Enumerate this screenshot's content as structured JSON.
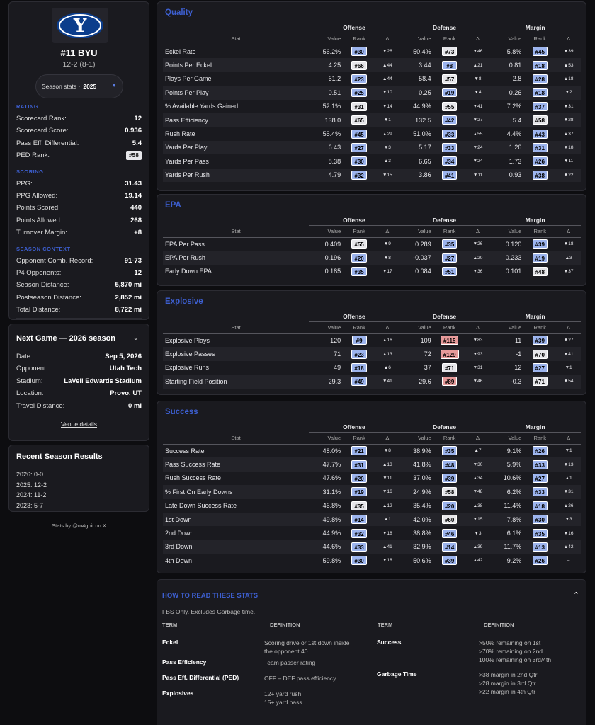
{
  "colors": {
    "accent": "#3d5fd0",
    "up": "#5fb86b",
    "down": "#d06a6a",
    "rank_blue": "#9cb4ee",
    "rank_light": "#e6e6ea",
    "rank_red": "#e79a9a"
  },
  "team": {
    "logo_text": "Y",
    "name": "#11 BYU",
    "record": "12-2 (8-1)",
    "season_label": "Season stats ·",
    "season_value": "2025"
  },
  "rating": {
    "title": "RATING",
    "rows": [
      {
        "label": "Scorecard Rank:",
        "value": "12"
      },
      {
        "label": "Scorecard Score:",
        "value": "0.936"
      },
      {
        "label": "Pass Eff. Differential:",
        "value": "5.4"
      },
      {
        "label": "PED Rank:",
        "value": "#58"
      }
    ]
  },
  "scoring": {
    "title": "SCORING",
    "rows": [
      {
        "label": "PPG:",
        "value": "31.43"
      },
      {
        "label": "PPG Allowed:",
        "value": "19.14"
      },
      {
        "label": "Points Scored:",
        "value": "440"
      },
      {
        "label": "Points Allowed:",
        "value": "268"
      },
      {
        "label": "Turnover Margin:",
        "value": "+8"
      }
    ]
  },
  "context": {
    "title": "SEASON CONTEXT",
    "rows": [
      {
        "label": "Opponent Comb. Record:",
        "value": "91-73"
      },
      {
        "label": "P4 Opponents:",
        "value": "12"
      },
      {
        "label": "Season Distance:",
        "value": "5,870 mi"
      },
      {
        "label": "Postseason Distance:",
        "value": "2,852 mi"
      },
      {
        "label": "Total Distance:",
        "value": "8,722 mi"
      }
    ]
  },
  "next_game": {
    "title": "Next Game — 2026 season",
    "rows": [
      {
        "label": "Date:",
        "value": "Sep 5, 2026"
      },
      {
        "label": "Opponent:",
        "value": "Utah Tech"
      },
      {
        "label": "Stadium:",
        "value": "LaVell Edwards Stadium"
      },
      {
        "label": "Location:",
        "value": "Provo, UT"
      },
      {
        "label": "Travel Distance:",
        "value": "0 mi"
      }
    ],
    "venue_link": "Venue details"
  },
  "recent": {
    "title": "Recent Season Results",
    "rows": [
      "2026: 0-0",
      "2025: 12-2",
      "2024: 11-2",
      "2023: 5-7"
    ]
  },
  "credits": "Stats by @m4gbit on X",
  "group_headers": {
    "offense": "Offense",
    "defense": "Defense",
    "margin": "Margin"
  },
  "col_headers": {
    "stat": "Stat",
    "value": "Value",
    "rank": "Rank",
    "delta": "Δ"
  },
  "sections": [
    {
      "key": "quality",
      "title": "Quality",
      "rows": [
        {
          "stat": "Eckel Rate",
          "o": [
            "56.2%",
            "#30",
            "b",
            "26",
            "d"
          ],
          "d": [
            "50.4%",
            "#73",
            "l",
            "46",
            "d"
          ],
          "m": [
            "5.8%",
            "#45",
            "b",
            "39",
            "d"
          ]
        },
        {
          "stat": "Points Per Eckel",
          "o": [
            "4.25",
            "#66",
            "l",
            "44",
            "u"
          ],
          "d": [
            "3.44",
            "#8",
            "b",
            "21",
            "u"
          ],
          "m": [
            "0.81",
            "#18",
            "b",
            "53",
            "u"
          ]
        },
        {
          "stat": "Plays Per Game",
          "o": [
            "61.2",
            "#23",
            "b",
            "44",
            "u"
          ],
          "d": [
            "58.4",
            "#57",
            "l",
            "8",
            "d"
          ],
          "m": [
            "2.8",
            "#28",
            "b",
            "18",
            "u"
          ]
        },
        {
          "stat": "Points Per Play",
          "o": [
            "0.51",
            "#25",
            "b",
            "10",
            "d"
          ],
          "d": [
            "0.25",
            "#19",
            "b",
            "4",
            "d"
          ],
          "m": [
            "0.26",
            "#18",
            "b",
            "2",
            "d"
          ]
        },
        {
          "stat": "% Available Yards Gained",
          "o": [
            "52.1%",
            "#31",
            "l",
            "14",
            "d"
          ],
          "d": [
            "44.9%",
            "#55",
            "l",
            "41",
            "d"
          ],
          "m": [
            "7.2%",
            "#37",
            "b",
            "31",
            "d"
          ]
        },
        {
          "stat": "Pass Efficiency",
          "o": [
            "138.0",
            "#65",
            "l",
            "1",
            "d"
          ],
          "d": [
            "132.5",
            "#42",
            "b",
            "27",
            "d"
          ],
          "m": [
            "5.4",
            "#58",
            "l",
            "28",
            "d"
          ]
        },
        {
          "stat": "Rush Rate",
          "o": [
            "55.4%",
            "#45",
            "b",
            "29",
            "u"
          ],
          "d": [
            "51.0%",
            "#33",
            "b",
            "55",
            "u"
          ],
          "m": [
            "4.4%",
            "#43",
            "b",
            "37",
            "u"
          ]
        },
        {
          "stat": "Yards Per Play",
          "o": [
            "6.43",
            "#27",
            "b",
            "3",
            "d"
          ],
          "d": [
            "5.17",
            "#33",
            "b",
            "24",
            "d"
          ],
          "m": [
            "1.26",
            "#31",
            "b",
            "18",
            "d"
          ]
        },
        {
          "stat": "Yards Per Pass",
          "o": [
            "8.38",
            "#30",
            "b",
            "3",
            "u"
          ],
          "d": [
            "6.65",
            "#34",
            "b",
            "24",
            "d"
          ],
          "m": [
            "1.73",
            "#26",
            "b",
            "11",
            "d"
          ]
        },
        {
          "stat": "Yards Per Rush",
          "o": [
            "4.79",
            "#32",
            "b",
            "15",
            "d"
          ],
          "d": [
            "3.86",
            "#41",
            "b",
            "11",
            "d"
          ],
          "m": [
            "0.93",
            "#38",
            "b",
            "22",
            "d"
          ]
        }
      ]
    },
    {
      "key": "epa",
      "title": "EPA",
      "rows": [
        {
          "stat": "EPA Per Pass",
          "o": [
            "0.409",
            "#55",
            "l",
            "9",
            "d"
          ],
          "d": [
            "0.289",
            "#35",
            "b",
            "26",
            "d"
          ],
          "m": [
            "0.120",
            "#39",
            "b",
            "18",
            "d"
          ]
        },
        {
          "stat": "EPA Per Rush",
          "o": [
            "0.196",
            "#20",
            "b",
            "8",
            "d"
          ],
          "d": [
            "-0.037",
            "#27",
            "b",
            "20",
            "u"
          ],
          "m": [
            "0.233",
            "#19",
            "b",
            "3",
            "u"
          ]
        },
        {
          "stat": "Early Down EPA",
          "o": [
            "0.185",
            "#35",
            "b",
            "17",
            "d"
          ],
          "d": [
            "0.084",
            "#51",
            "b",
            "36",
            "d"
          ],
          "m": [
            "0.101",
            "#48",
            "l",
            "37",
            "d"
          ]
        }
      ]
    },
    {
      "key": "explosive",
      "title": "Explosive",
      "rows": [
        {
          "stat": "Explosive Plays",
          "o": [
            "120",
            "#9",
            "b",
            "16",
            "u"
          ],
          "d": [
            "109",
            "#115",
            "r",
            "83",
            "d"
          ],
          "m": [
            "11",
            "#39",
            "b",
            "27",
            "d"
          ]
        },
        {
          "stat": "Explosive Passes",
          "o": [
            "71",
            "#23",
            "b",
            "13",
            "u"
          ],
          "d": [
            "72",
            "#129",
            "r",
            "93",
            "d"
          ],
          "m": [
            "-1",
            "#70",
            "l",
            "41",
            "d"
          ]
        },
        {
          "stat": "Explosive Runs",
          "o": [
            "49",
            "#18",
            "b",
            "6",
            "u"
          ],
          "d": [
            "37",
            "#71",
            "l",
            "31",
            "d"
          ],
          "m": [
            "12",
            "#27",
            "b",
            "1",
            "d"
          ]
        },
        {
          "stat": "Starting Field Position",
          "o": [
            "29.3",
            "#49",
            "b",
            "41",
            "d"
          ],
          "d": [
            "29.6",
            "#89",
            "r",
            "46",
            "d"
          ],
          "m": [
            "-0.3",
            "#71",
            "l",
            "54",
            "d"
          ]
        }
      ]
    },
    {
      "key": "success",
      "title": "Success",
      "rows": [
        {
          "stat": "Success Rate",
          "o": [
            "48.0%",
            "#21",
            "b",
            "8",
            "d"
          ],
          "d": [
            "38.9%",
            "#35",
            "b",
            "7",
            "u"
          ],
          "m": [
            "9.1%",
            "#26",
            "b",
            "1",
            "d"
          ]
        },
        {
          "stat": "Pass Success Rate",
          "o": [
            "47.7%",
            "#31",
            "b",
            "13",
            "u"
          ],
          "d": [
            "41.8%",
            "#48",
            "b",
            "30",
            "d"
          ],
          "m": [
            "5.9%",
            "#33",
            "b",
            "13",
            "d"
          ]
        },
        {
          "stat": "Rush Success Rate",
          "o": [
            "47.6%",
            "#20",
            "b",
            "11",
            "d"
          ],
          "d": [
            "37.0%",
            "#39",
            "b",
            "34",
            "u"
          ],
          "m": [
            "10.6%",
            "#27",
            "b",
            "1",
            "u"
          ]
        },
        {
          "stat": "% First On Early Downs",
          "o": [
            "31.1%",
            "#19",
            "b",
            "16",
            "d"
          ],
          "d": [
            "24.9%",
            "#58",
            "l",
            "48",
            "d"
          ],
          "m": [
            "6.2%",
            "#33",
            "b",
            "31",
            "d"
          ]
        },
        {
          "stat": "Late Down Success Rate",
          "o": [
            "46.8%",
            "#35",
            "l",
            "12",
            "u"
          ],
          "d": [
            "35.4%",
            "#20",
            "b",
            "38",
            "u"
          ],
          "m": [
            "11.4%",
            "#18",
            "b",
            "26",
            "u"
          ]
        },
        {
          "stat": "1st Down",
          "o": [
            "49.8%",
            "#14",
            "b",
            "1",
            "u"
          ],
          "d": [
            "42.0%",
            "#60",
            "l",
            "15",
            "d"
          ],
          "m": [
            "7.8%",
            "#30",
            "b",
            "3",
            "d"
          ]
        },
        {
          "stat": "2nd Down",
          "o": [
            "44.9%",
            "#32",
            "b",
            "18",
            "d"
          ],
          "d": [
            "38.8%",
            "#46",
            "b",
            "3",
            "d"
          ],
          "m": [
            "6.1%",
            "#35",
            "b",
            "16",
            "d"
          ]
        },
        {
          "stat": "3rd Down",
          "o": [
            "44.6%",
            "#33",
            "b",
            "41",
            "u"
          ],
          "d": [
            "32.9%",
            "#14",
            "b",
            "39",
            "u"
          ],
          "m": [
            "11.7%",
            "#13",
            "b",
            "42",
            "u"
          ]
        },
        {
          "stat": "4th Down",
          "o": [
            "59.8%",
            "#30",
            "b",
            "18",
            "d"
          ],
          "d": [
            "50.6%",
            "#39",
            "b",
            "42",
            "u"
          ],
          "m": [
            "9.2%",
            "#26",
            "b",
            "–",
            "n"
          ]
        }
      ]
    }
  ],
  "how": {
    "title": "HOW TO READ THESE STATS",
    "note": "FBS Only. Excludes Garbage time.",
    "term_header": "TERM",
    "def_header": "DEFINITION",
    "left": [
      {
        "term": "Eckel",
        "def": "Scoring drive or 1st down inside\nthe opponent 40"
      },
      {
        "term": "Pass Efficiency",
        "def": "Team passer rating"
      },
      {
        "term": "Pass Eff. Differential (PED)",
        "def": "OFF – DEF pass efficiency"
      },
      {
        "term": "Explosives",
        "def": "12+ yard rush\n15+ yard pass"
      }
    ],
    "right": [
      {
        "term": "Success",
        "def": ">50% remaining on 1st\n>70% remaining on 2nd\n100% remaining on 3rd/4th"
      },
      {
        "term": "Garbage Time",
        "def": ">38 margin in 2nd Qtr\n>28 margin in 3rd Qtr\n>22 margin in 4th Qtr"
      }
    ]
  }
}
